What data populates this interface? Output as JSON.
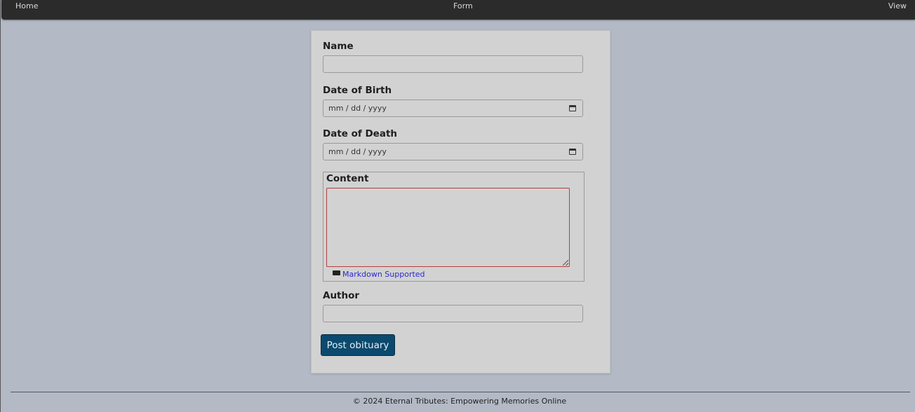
{
  "nav": {
    "home": "Home",
    "form": "Form",
    "view": "View"
  },
  "form": {
    "name_label": "Name",
    "name_value": "",
    "birth_label": "Date of Birth",
    "birth_placeholder": "mm / dd / yyyy",
    "death_label": "Date of Death",
    "death_placeholder": "mm / dd / yyyy",
    "content_label": "Content",
    "content_value": "",
    "markdown_text": "Markdown Supported",
    "author_label": "Author",
    "author_value": "",
    "submit_label": "Post obituary"
  },
  "footer": {
    "text": "© 2024 Eternal Tributes: Empowering Memories Online"
  },
  "icons": {
    "date_icon": "calendar-icon",
    "markdown_icon": "markdown-icon"
  },
  "colors": {
    "submit_bg": "#0b4a6e",
    "link": "#2a2ad0",
    "textarea_border": "#b04040"
  }
}
